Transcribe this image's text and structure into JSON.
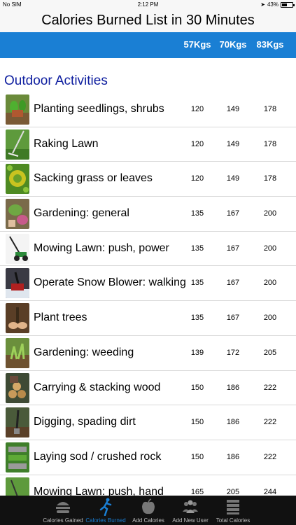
{
  "status": {
    "carrier": "No SIM",
    "time": "2:12 PM",
    "battery": "43%",
    "battery_level": 0.43
  },
  "title": "Calories Burned List in 30 Minutes",
  "columns": [
    "57Kgs",
    "70Kgs",
    "83Kgs"
  ],
  "section": "Outdoor Activities",
  "activities": [
    {
      "name": "Planting seedlings, shrubs",
      "values": [
        "120",
        "149",
        "178"
      ],
      "icon": "seedlings-thumbnail"
    },
    {
      "name": "Raking Lawn",
      "values": [
        "120",
        "149",
        "178"
      ],
      "icon": "rake-thumbnail"
    },
    {
      "name": "Sacking grass or leaves",
      "values": [
        "120",
        "149",
        "178"
      ],
      "icon": "leaves-thumbnail"
    },
    {
      "name": "Gardening: general",
      "values": [
        "135",
        "167",
        "200"
      ],
      "icon": "gardening-thumbnail"
    },
    {
      "name": "Mowing Lawn: push, power",
      "values": [
        "135",
        "167",
        "200"
      ],
      "icon": "mower-thumbnail"
    },
    {
      "name": "Operate Snow Blower: walking",
      "values": [
        "135",
        "167",
        "200"
      ],
      "icon": "snow-blower-thumbnail"
    },
    {
      "name": "Plant trees",
      "values": [
        "135",
        "167",
        "200"
      ],
      "icon": "tree-planting-thumbnail"
    },
    {
      "name": "Gardening: weeding",
      "values": [
        "139",
        "172",
        "205"
      ],
      "icon": "weeding-thumbnail"
    },
    {
      "name": "Carrying & stacking wood",
      "values": [
        "150",
        "186",
        "222"
      ],
      "icon": "wood-thumbnail"
    },
    {
      "name": "Digging, spading dirt",
      "values": [
        "150",
        "186",
        "222"
      ],
      "icon": "digging-thumbnail"
    },
    {
      "name": "Laying sod / crushed rock",
      "values": [
        "150",
        "186",
        "222"
      ],
      "icon": "sod-thumbnail"
    },
    {
      "name": "Mowing Lawn: push, hand",
      "values": [
        "165",
        "205",
        "244"
      ],
      "icon": "hand-mower-thumbnail"
    }
  ],
  "tabs": [
    {
      "label": "Calories Gained",
      "icon": "burger-icon",
      "active": false
    },
    {
      "label": "Calories Burned",
      "icon": "runner-icon",
      "active": true
    },
    {
      "label": "Add Calories",
      "icon": "apple-icon",
      "active": false
    },
    {
      "label": "Add New User",
      "icon": "users-icon",
      "active": false
    },
    {
      "label": "Total Calories",
      "icon": "list-icon",
      "active": false
    }
  ],
  "colors": {
    "accent": "#1a7fd4",
    "section_title": "#1020a0",
    "tabbar": "#111111"
  }
}
